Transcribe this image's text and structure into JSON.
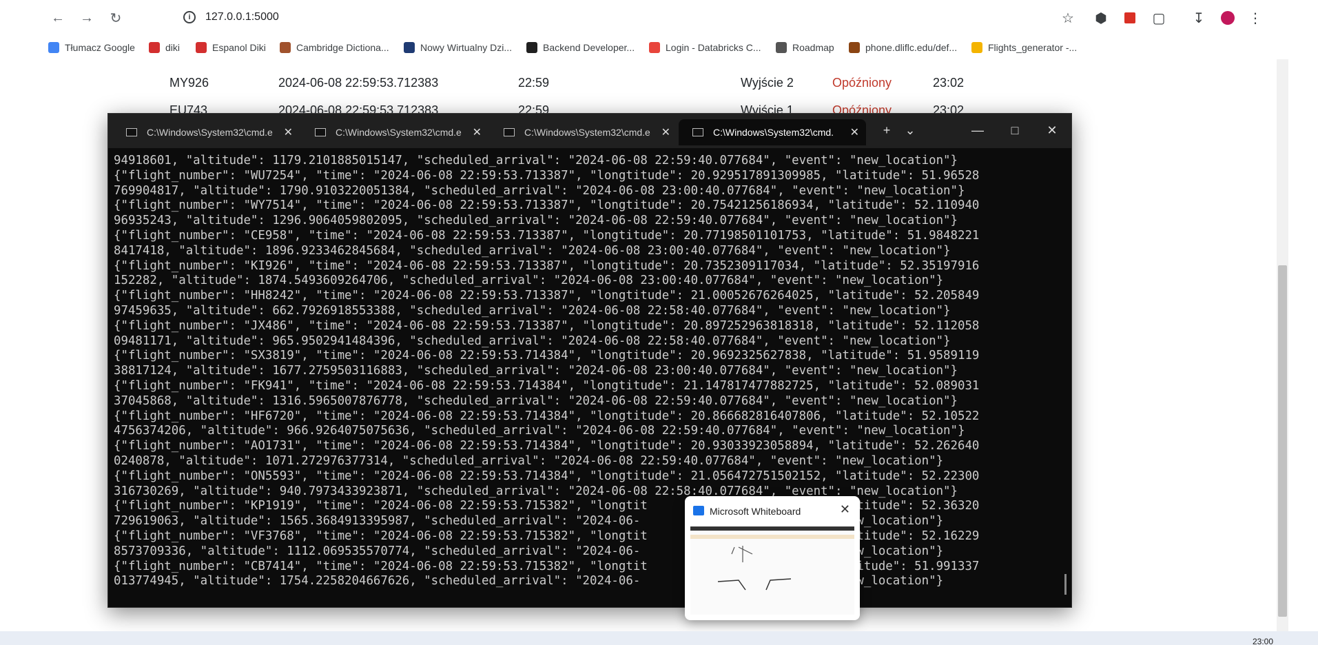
{
  "browser": {
    "url": "127.0.0.1:5000",
    "bookmarks": [
      {
        "label": "Tłumacz Google",
        "color": "#4285f4"
      },
      {
        "label": "diki",
        "color": "#d32f2f"
      },
      {
        "label": "Espanol Diki",
        "color": "#d32f2f"
      },
      {
        "label": "Cambridge Dictiona...",
        "color": "#a0522d"
      },
      {
        "label": "Nowy Wirtualny Dzi...",
        "color": "#1f3b73"
      },
      {
        "label": "Backend Developer...",
        "color": "#202020"
      },
      {
        "label": "Login - Databricks C...",
        "color": "#e8453c"
      },
      {
        "label": "Roadmap",
        "color": "#555555"
      },
      {
        "label": "phone.dliflc.edu/def...",
        "color": "#8b4513"
      },
      {
        "label": "Flights_generator -...",
        "color": "#f4b400"
      }
    ]
  },
  "flights": [
    {
      "number": "MY926",
      "time": "2024-06-08 22:59:53.712383",
      "sched": "22:59",
      "gate": "Wyjście 2",
      "status": "Opóźniony",
      "est": "23:02"
    },
    {
      "number": "EU743",
      "time": "2024-06-08 22:59:53.712383",
      "sched": "22:59",
      "gate": "Wyjście 1",
      "status": "Opóźniony",
      "est": "23:02"
    }
  ],
  "terminal": {
    "tabs": [
      "C:\\Windows\\System32\\cmd.e",
      "C:\\Windows\\System32\\cmd.e",
      "C:\\Windows\\System32\\cmd.e",
      "C:\\Windows\\System32\\cmd."
    ],
    "lines": [
      "94918601, \"altitude\": 1179.2101885015147, \"scheduled_arrival\": \"2024-06-08 22:59:40.077684\", \"event\": \"new_location\"}",
      "{\"flight_number\": \"WU7254\", \"time\": \"2024-06-08 22:59:53.713387\", \"longtitude\": 20.929517891309985, \"latitude\": 51.96528",
      "769904817, \"altitude\": 1790.9103220051384, \"scheduled_arrival\": \"2024-06-08 23:00:40.077684\", \"event\": \"new_location\"}",
      "{\"flight_number\": \"WY7514\", \"time\": \"2024-06-08 22:59:53.713387\", \"longtitude\": 20.75421256186934, \"latitude\": 52.110940",
      "96935243, \"altitude\": 1296.9064059802095, \"scheduled_arrival\": \"2024-06-08 22:59:40.077684\", \"event\": \"new_location\"}",
      "{\"flight_number\": \"CE958\", \"time\": \"2024-06-08 22:59:53.713387\", \"longtitude\": 20.77198501101753, \"latitude\": 51.9848221",
      "8417418, \"altitude\": 1896.9233462845684, \"scheduled_arrival\": \"2024-06-08 23:00:40.077684\", \"event\": \"new_location\"}",
      "{\"flight_number\": \"KI926\", \"time\": \"2024-06-08 22:59:53.713387\", \"longtitude\": 20.7352309117034, \"latitude\": 52.35197916",
      "152282, \"altitude\": 1874.5493609264706, \"scheduled_arrival\": \"2024-06-08 23:00:40.077684\", \"event\": \"new_location\"}",
      "{\"flight_number\": \"HH8242\", \"time\": \"2024-06-08 22:59:53.713387\", \"longtitude\": 21.00052676264025, \"latitude\": 52.205849",
      "97459635, \"altitude\": 662.7926918553388, \"scheduled_arrival\": \"2024-06-08 22:58:40.077684\", \"event\": \"new_location\"}",
      "{\"flight_number\": \"JX486\", \"time\": \"2024-06-08 22:59:53.713387\", \"longtitude\": 20.897252963818318, \"latitude\": 52.112058",
      "09481171, \"altitude\": 965.9502941484396, \"scheduled_arrival\": \"2024-06-08 22:58:40.077684\", \"event\": \"new_location\"}",
      "{\"flight_number\": \"SX3819\", \"time\": \"2024-06-08 22:59:53.714384\", \"longtitude\": 20.9692325627838, \"latitude\": 51.9589119",
      "38817124, \"altitude\": 1677.2759503116883, \"scheduled_arrival\": \"2024-06-08 23:00:40.077684\", \"event\": \"new_location\"}",
      "{\"flight_number\": \"FK941\", \"time\": \"2024-06-08 22:59:53.714384\", \"longtitude\": 21.147817477882725, \"latitude\": 52.089031",
      "37045868, \"altitude\": 1316.5965007876778, \"scheduled_arrival\": \"2024-06-08 22:59:40.077684\", \"event\": \"new_location\"}",
      "{\"flight_number\": \"HF6720\", \"time\": \"2024-06-08 22:59:53.714384\", \"longtitude\": 20.866682816407806, \"latitude\": 52.10522",
      "4756374206, \"altitude\": 966.9264075075636, \"scheduled_arrival\": \"2024-06-08 22:59:40.077684\", \"event\": \"new_location\"}",
      "{\"flight_number\": \"AO1731\", \"time\": \"2024-06-08 22:59:53.714384\", \"longtitude\": 20.93033923058894, \"latitude\": 52.262640",
      "0240878, \"altitude\": 1071.272976377314, \"scheduled_arrival\": \"2024-06-08 22:59:40.077684\", \"event\": \"new_location\"}",
      "{\"flight_number\": \"ON5593\", \"time\": \"2024-06-08 22:59:53.714384\", \"longtitude\": 21.056472751502152, \"latitude\": 52.22300",
      "316730269, \"altitude\": 940.7973433923871, \"scheduled_arrival\": \"2024-06-08 22:58:40.077684\", \"event\": \"new_location\"}",
      "{\"flight_number\": \"KP1919\", \"time\": \"2024-06-08 22:59:53.715382\", \"longtit                     568, \"latitude\": 52.36320",
      "729619063, \"altitude\": 1565.3684913395987, \"scheduled_arrival\": \"2024-06-                   event\": \"new_location\"}",
      "{\"flight_number\": \"VF3768\", \"time\": \"2024-06-08 22:59:53.715382\", \"longtit                     774, \"latitude\": 52.16229",
      "8573709336, \"altitude\": 1112.069535570774, \"scheduled_arrival\": \"2024-06-                   event\": \"new_location\"}",
      "{\"flight_number\": \"CB7414\", \"time\": \"2024-06-08 22:59:53.715382\", \"longtit                     97, \"latitude\": 51.991337",
      "013774945, \"altitude\": 1754.2258204667626, \"scheduled_arrival\": \"2024-06-                   event\": \"new_location\"}"
    ]
  },
  "whiteboard": {
    "title": "Microsoft Whiteboard"
  },
  "taskbar": {
    "clock": "23:00"
  },
  "colors": {
    "status_late": "#c0392b",
    "terminal_bg": "#0c0c0c",
    "terminal_fg": "#cccccc"
  }
}
